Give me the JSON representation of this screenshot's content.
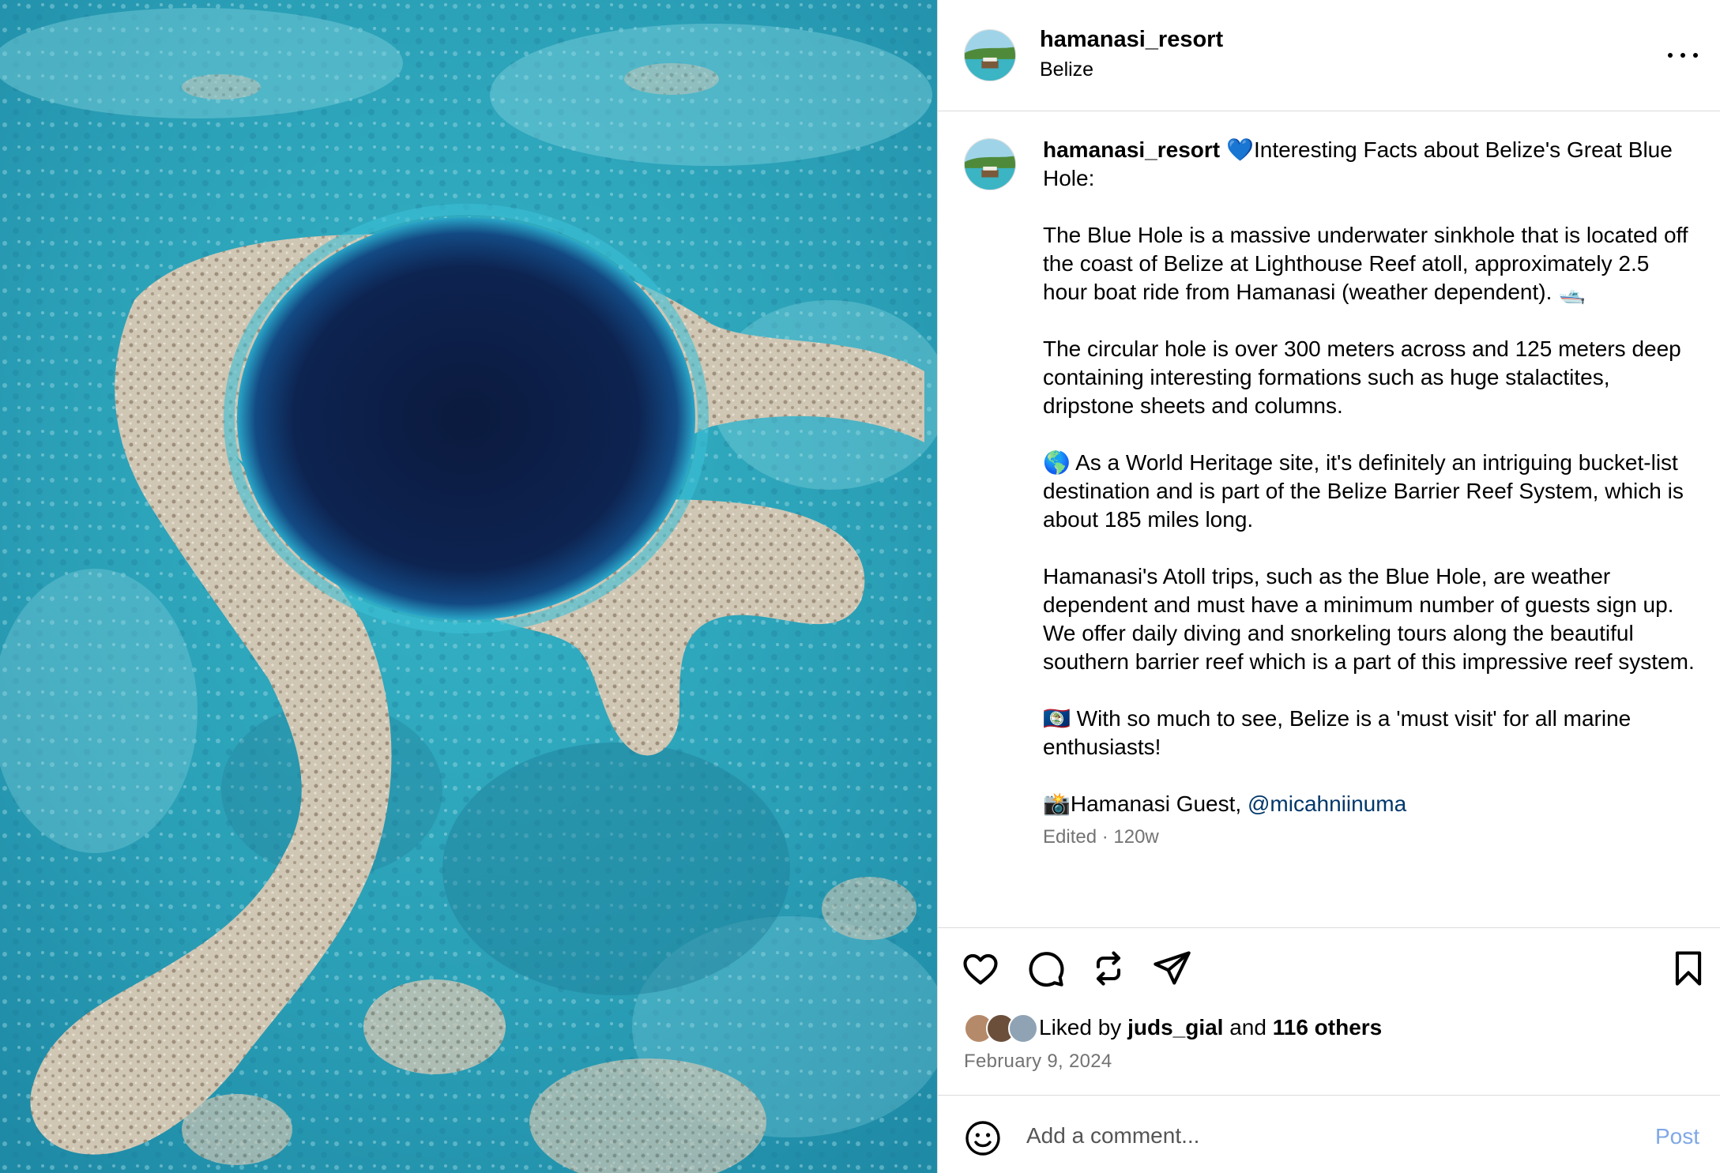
{
  "post": {
    "username": "hamanasi_resort",
    "location": "Belize"
  },
  "caption": {
    "username": "hamanasi_resort",
    "title": "💙Interesting Facts about Belize's Great Blue Hole:",
    "p1": "The Blue Hole is a massive underwater sinkhole that is located off the coast of Belize at Lighthouse Reef atoll, approximately 2.5 hour boat ride from Hamanasi (weather dependent). 🛥️",
    "p2": "The circular hole is over 300 meters across and 125 meters deep containing interesting formations such as huge stalactites, dripstone sheets and columns.",
    "p3": "🌎 As a World Heritage site, it's definitely an intriguing bucket-list destination and is part of the Belize Barrier Reef System, which is about 185 miles long.",
    "p4": "Hamanasi's Atoll trips, such as the Blue Hole, are weather dependent and must have a minimum number of guests sign up. We offer daily diving and snorkeling tours along the beautiful southern barrier reef which is a part of this impressive reef system.",
    "p5": "🇧🇿 With so much to see, Belize is a 'must visit' for all marine enthusiasts!",
    "credit_prefix": "📸Hamanasi Guest, ",
    "credit_mention": "@micahniinuma",
    "edited": "Edited",
    "separator": " · ",
    "age": "120w"
  },
  "likes": {
    "prefix": "Liked by ",
    "user": "juds_gial",
    "middle": " and ",
    "others": "116 others"
  },
  "date": "February 9, 2024",
  "comment": {
    "placeholder": "Add a comment...",
    "post_label": "Post"
  },
  "icons": {
    "more": "more-options-icon",
    "like": "heart-icon",
    "comment": "comment-bubble-icon",
    "repost": "repost-icon",
    "share": "send-icon",
    "save": "bookmark-icon",
    "emoji": "smiley-icon"
  },
  "colors": {
    "mention": "#00376b",
    "post_button": "#7fa8e6",
    "meta_text": "#737373",
    "divider": "#dbdbdb"
  }
}
